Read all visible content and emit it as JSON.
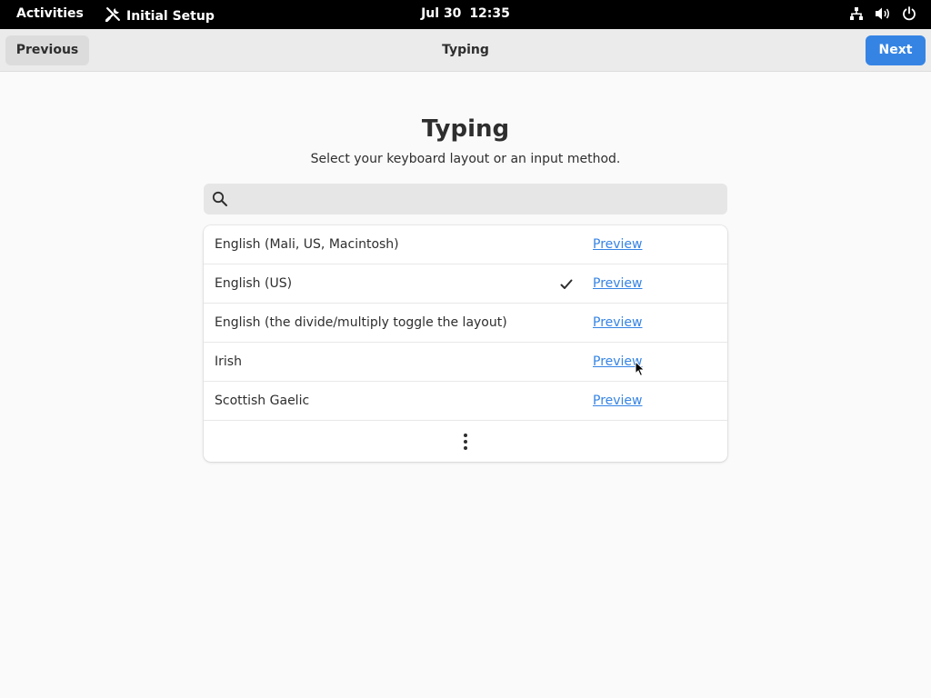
{
  "topbar": {
    "activities": "Activities",
    "app_name": "Initial Setup",
    "app_icon": "tools-icon",
    "date": "Jul 30",
    "time": "12:35",
    "tray_icons": [
      "network-icon",
      "volume-icon",
      "power-icon"
    ]
  },
  "headerbar": {
    "previous_label": "Previous",
    "title": "Typing",
    "next_label": "Next"
  },
  "main": {
    "title": "Typing",
    "subtitle": "Select your keyboard layout or an input method.",
    "search": {
      "value": "",
      "placeholder": "",
      "icon": "search-icon"
    },
    "layouts": [
      {
        "label": "English (Mali, US, Macintosh)",
        "selected": false,
        "preview": "Preview"
      },
      {
        "label": "English (US)",
        "selected": true,
        "preview": "Preview"
      },
      {
        "label": "English (the divide/multiply toggle the layout)",
        "selected": false,
        "preview": "Preview"
      },
      {
        "label": "Irish",
        "selected": false,
        "preview": "Preview"
      },
      {
        "label": "Scottish Gaelic",
        "selected": false,
        "preview": "Preview"
      }
    ],
    "more_icon": "view-more-icon"
  },
  "colors": {
    "accent": "#3584e4",
    "topbar_bg": "#000000",
    "header_bg": "#ebebeb",
    "page_bg": "#fafafa"
  }
}
